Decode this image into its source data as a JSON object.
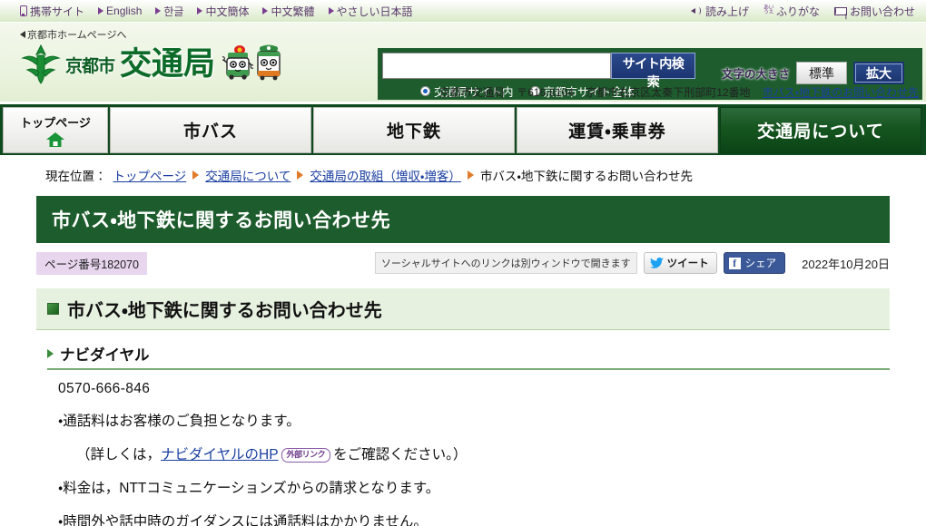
{
  "utility_bar": {
    "left_items": [
      {
        "label": "携帯サイト",
        "icon": "mobile-phone-icon"
      },
      {
        "label": "English",
        "icon": "triangle-icon"
      },
      {
        "label": "한글",
        "icon": "triangle-icon"
      },
      {
        "label": "中文簡体",
        "icon": "triangle-icon"
      },
      {
        "label": "中文繁體",
        "icon": "triangle-icon"
      },
      {
        "label": "やさしい日本語",
        "icon": "triangle-icon"
      }
    ],
    "right_items": [
      {
        "label": "読み上げ",
        "icon": "speaker-icon"
      },
      {
        "label": "ふりがな",
        "icon": "furigana-icon",
        "glyph_top": "あい",
        "glyph_bottom": "うえ"
      },
      {
        "label": "お問い合わせ",
        "icon": "mail-icon"
      }
    ]
  },
  "header": {
    "back_link": "京都市ホームページへ",
    "brand_city": "京都市",
    "brand_main": "交通局",
    "address": {
      "org": "京都市交通局",
      "postal": "〒616-8104",
      "street": "京都市右京区太秦下刑部町12番地",
      "link": "市バス・地下鉄のお問い合わせ先"
    }
  },
  "search": {
    "value": "",
    "placeholder": "",
    "button_label": "サイト内検索",
    "options": [
      {
        "label": "交通局サイト内",
        "selected": true
      },
      {
        "label": "京都市サイト全体",
        "selected": false
      }
    ]
  },
  "font_size": {
    "label": "文字の大きさ",
    "standard": "標準",
    "large": "拡大"
  },
  "global_nav": [
    {
      "label": "トップページ",
      "icon": "home-icon",
      "active": false
    },
    {
      "label": "市バス",
      "active": false
    },
    {
      "label": "地下鉄",
      "active": false
    },
    {
      "label": "運賃・乗車券",
      "active": false
    },
    {
      "label": "交通局について",
      "active": true
    }
  ],
  "breadcrumb": {
    "prefix": "現在位置：",
    "items": [
      {
        "label": "トップページ",
        "link": true
      },
      {
        "label": "交通局について",
        "link": true
      },
      {
        "label": "交通局の取組（増収・増客）",
        "link": true
      },
      {
        "label": "市バス・地下鉄に関するお問い合わせ先",
        "link": false
      }
    ]
  },
  "page": {
    "title": "市バス・地下鉄に関するお問い合わせ先",
    "page_number": "ページ番号182070",
    "social_note": "ソーシャルサイトへのリンクは別ウィンドウで開きます",
    "tweet_label": "ツイート",
    "share_label": "シェア",
    "date": "2022年10月20日"
  },
  "section": {
    "heading": "市バス・地下鉄に関するお問い合わせ先",
    "sub_heading": "ナビダイヤル",
    "phone": "0570-666-846",
    "lines": [
      {
        "text": "・通話料はお客様のご負担となります。",
        "indent": false
      },
      {
        "indent": true,
        "prefix": "（詳しくは，",
        "link": "ナビダイヤルのHP",
        "badge": "外部リンク",
        "suffix": "をご確認ください。）"
      },
      {
        "text": "・料金は，NTTコミュニケーションズからの請求となります。",
        "indent": false
      },
      {
        "text": "・時間外や話中時のガイダンスには通話料はかかりません。",
        "indent": false
      }
    ]
  },
  "colors": {
    "brand_green": "#0c6b28",
    "nav_green": "#0f4a1e",
    "title_green": "#1d5c2c",
    "link_blue": "#1a3fa0",
    "badge_purple": "#e8d6ef",
    "search_navy": "#1b3570"
  }
}
